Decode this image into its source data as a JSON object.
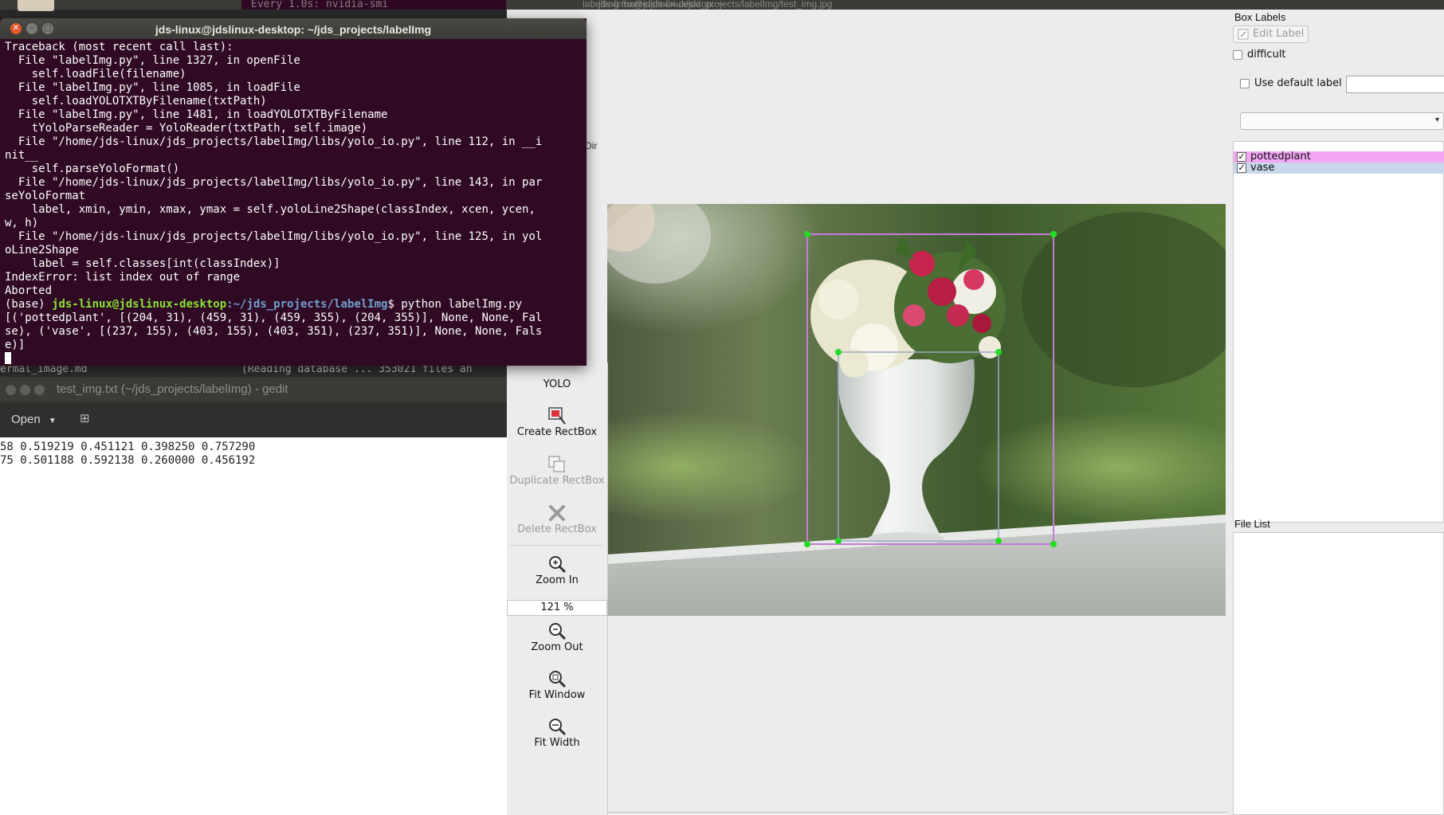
{
  "desktop": {
    "bg_terminal_strip": "Every 1.0s: nvidia-smi",
    "bg_terminal_title": "jds-linux@jdslinux-desktop: ~",
    "labelimg_window_title": "labelImg /home/jds-linux/jds_projects/labelImg/test_img.jpg",
    "bg_file_name": "ermal_image.md",
    "bg_terminal_apt": "(Reading database ... 353021 files an",
    "dir_stub": "Dir"
  },
  "terminal": {
    "title": "jds-linux@jdslinux-desktop: ~/jds_projects/labelImg",
    "output_lines": [
      "Traceback (most recent call last):",
      "  File \"labelImg.py\", line 1327, in openFile",
      "    self.loadFile(filename)",
      "  File \"labelImg.py\", line 1085, in loadFile",
      "    self.loadYOLOTXTByFilename(txtPath)",
      "  File \"labelImg.py\", line 1481, in loadYOLOTXTByFilename",
      "    tYoloParseReader = YoloReader(txtPath, self.image)",
      "  File \"/home/jds-linux/jds_projects/labelImg/libs/yolo_io.py\", line 112, in __i",
      "nit__",
      "    self.parseYoloFormat()",
      "  File \"/home/jds-linux/jds_projects/labelImg/libs/yolo_io.py\", line 143, in par",
      "seYoloFormat",
      "    label, xmin, ymin, xmax, ymax = self.yoloLine2Shape(classIndex, xcen, ycen,",
      "w, h)",
      "  File \"/home/jds-linux/jds_projects/labelImg/libs/yolo_io.py\", line 125, in yol",
      "oLine2Shape",
      "    label = self.classes[int(classIndex)]",
      "IndexError: list index out of range",
      "Aborted"
    ],
    "prompt_env": "(base) ",
    "prompt_user": "jds-linux@jdslinux-desktop",
    "prompt_path": ":~/jds_projects/labelImg",
    "prompt_symbol": "$ ",
    "command": "python labelImg.py",
    "result_lines": [
      "[('pottedplant', [(204, 31), (459, 31), (459, 355), (204, 355)], None, None, Fal",
      "se), ('vase', [(237, 155), (403, 155), (403, 351), (237, 351)], None, None, Fals",
      "e)]"
    ]
  },
  "gedit": {
    "title": "test_img.txt (~/jds_projects/labelImg) - gedit",
    "open_label": "Open",
    "lines": [
      "58 0.519219 0.451121 0.398250 0.757290",
      "75 0.501188 0.592138 0.260000 0.456192"
    ]
  },
  "toolbar": {
    "format_label": "YOLO",
    "create_rectbox": "Create RectBox",
    "duplicate_rectbox": "Duplicate RectBox",
    "delete_rectbox": "Delete RectBox",
    "zoom_in": "Zoom In",
    "zoom_value": "121 %",
    "zoom_out": "Zoom Out",
    "fit_window": "Fit Window",
    "fit_width": "Fit Width"
  },
  "dock": {
    "box_labels_title": "Box Labels",
    "edit_label": "Edit Label",
    "difficult": "difficult",
    "use_default_label": "Use default label",
    "default_label_value": "",
    "labels": [
      {
        "name": "pottedplant",
        "checked": true,
        "color": "#f3a6f3"
      },
      {
        "name": "vase",
        "checked": true,
        "color": "#c8d8ea"
      }
    ],
    "file_list_title": "File List"
  },
  "annotations": [
    {
      "label": "pottedplant",
      "color": "#c77ad9"
    },
    {
      "label": "vase",
      "color": "#9aa8c6"
    }
  ],
  "colors": {
    "terminal_bg": "#300a24",
    "prompt_user": "#8ae234",
    "prompt_path": "#729fcf",
    "close_button": "#e05a2b",
    "handle": "#22dd22"
  }
}
